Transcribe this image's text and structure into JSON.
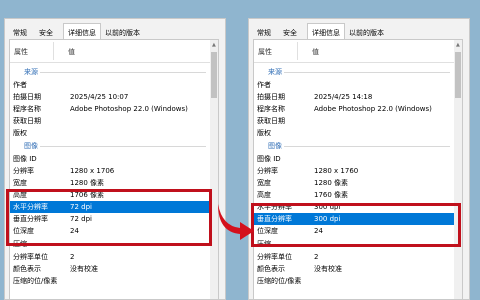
{
  "tabs": [
    "常规",
    "安全",
    "详细信息",
    "以前的版本"
  ],
  "columns": {
    "property": "属性",
    "value": "值"
  },
  "sections": {
    "source": "来源",
    "image": "图像"
  },
  "colors": {
    "selection": "#0078d7",
    "highlight_box": "#c0101c",
    "arrow": "#d4101c",
    "section": "#2f6db5"
  },
  "left": {
    "source_rows": [
      {
        "k": "作者",
        "v": ""
      },
      {
        "k": "拍摄日期",
        "v": "2025/4/25 10:07"
      },
      {
        "k": "程序名称",
        "v": "Adobe Photoshop 22.0 (Windows)"
      },
      {
        "k": "获取日期",
        "v": ""
      },
      {
        "k": "版权",
        "v": ""
      }
    ],
    "image_rows": [
      {
        "k": "图像 ID",
        "v": ""
      },
      {
        "k": "分辨率",
        "v": "1280 x 1706"
      },
      {
        "k": "宽度",
        "v": "1280 像素"
      },
      {
        "k": "高度",
        "v": "1706 像素"
      },
      {
        "k": "水平分辨率",
        "v": "72 dpi"
      },
      {
        "k": "垂直分辨率",
        "v": "72 dpi"
      },
      {
        "k": "位深度",
        "v": "24"
      },
      {
        "k": "压缩",
        "v": ""
      },
      {
        "k": "分辨率单位",
        "v": "2"
      },
      {
        "k": "颜色表示",
        "v": "没有校准"
      },
      {
        "k": "压缩的位/像素",
        "v": ""
      }
    ]
  },
  "right": {
    "source_rows": [
      {
        "k": "作者",
        "v": ""
      },
      {
        "k": "拍摄日期",
        "v": "2025/4/25 14:18"
      },
      {
        "k": "程序名称",
        "v": "Adobe Photoshop 22.0 (Windows)"
      },
      {
        "k": "获取日期",
        "v": ""
      },
      {
        "k": "版权",
        "v": ""
      }
    ],
    "image_rows": [
      {
        "k": "图像 ID",
        "v": ""
      },
      {
        "k": "分辨率",
        "v": "1280 x 1760"
      },
      {
        "k": "宽度",
        "v": "1280 像素"
      },
      {
        "k": "高度",
        "v": "1760 像素"
      },
      {
        "k": "水平分辨率",
        "v": "300 dpi"
      },
      {
        "k": "垂直分辨率",
        "v": "300 dpi"
      },
      {
        "k": "位深度",
        "v": "24"
      },
      {
        "k": "压缩",
        "v": ""
      },
      {
        "k": "分辨率单位",
        "v": "2"
      },
      {
        "k": "颜色表示",
        "v": "没有校准"
      },
      {
        "k": "压缩的位/像素",
        "v": ""
      }
    ]
  }
}
